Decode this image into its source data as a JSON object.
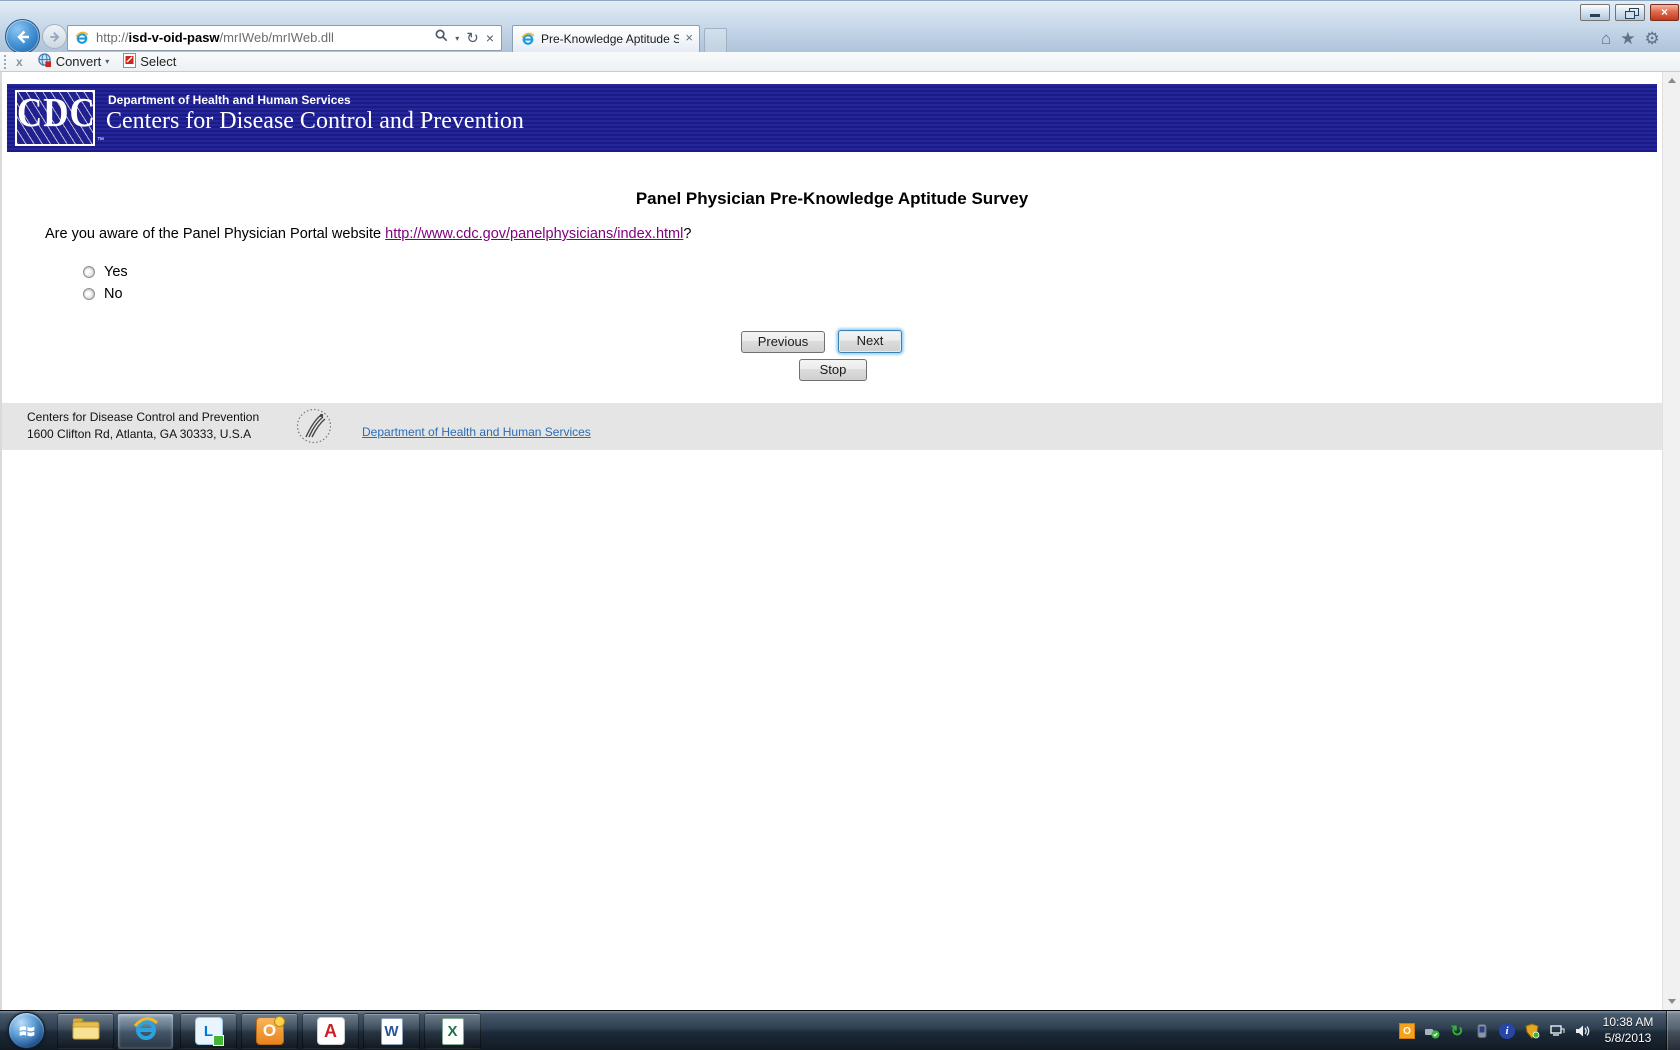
{
  "browser": {
    "address": {
      "protocol": "http://",
      "domain": "isd-v-oid-pasw",
      "path": "/mrIWeb/mrIWeb.dll"
    },
    "tab_title": "Pre-Knowledge Aptitude S..."
  },
  "command_bar": {
    "close_label": "x",
    "convert_label": "Convert",
    "select_label": "Select"
  },
  "icons": {
    "close": "×",
    "home": "⌂",
    "favorites": "★",
    "tools": "⚙",
    "refresh": "↻",
    "dropdown_caret": "▾",
    "sync_tray": "↻",
    "outlook_tray": "O",
    "info_tray": "i"
  },
  "cdc_header": {
    "logo": "CDC",
    "trademark": "™",
    "department": "Department of Health and Human Services",
    "organization": "Centers for Disease Control and Prevention"
  },
  "survey": {
    "title": "Panel Physician Pre-Knowledge Aptitude Survey",
    "question": {
      "prefix": "Are you aware of the Panel Physician Portal website ",
      "link_text": "http://www.cdc.gov/panelphysicians/index.html",
      "suffix": "?"
    },
    "options": [
      {
        "label": "Yes",
        "selected": false
      },
      {
        "label": "No",
        "selected": false
      }
    ],
    "buttons": {
      "previous": "Previous",
      "next": "Next",
      "stop": "Stop"
    }
  },
  "footer": {
    "org": "Centers for Disease Control and Prevention",
    "address": "1600 Clifton Rd, Atlanta, GA 30333, U.S.A",
    "hhs_link": "Department of Health and Human Services"
  },
  "taskbar": {
    "time": "10:38 AM",
    "date": "5/8/2013",
    "app_glyphs": {
      "lync": "L",
      "outlook": "O",
      "acrobat": "A",
      "word": "W",
      "excel": "X"
    }
  },
  "colors": {
    "banner_bg": "#20208e",
    "visited_link": "#7d007d",
    "footer_link": "#2a6db5",
    "footer_bg": "#e5e5e5",
    "taskbar_bg": "#2e3f50"
  }
}
